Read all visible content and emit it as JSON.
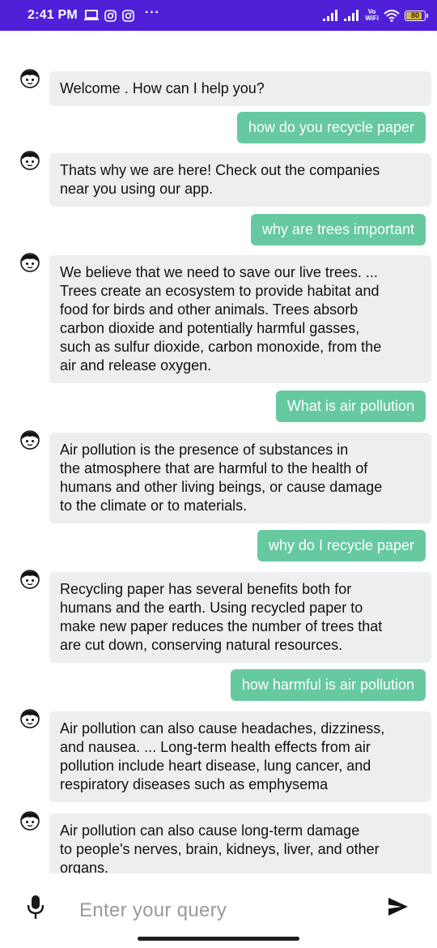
{
  "status_bar": {
    "time": "2:41 PM",
    "icons_left": [
      "laptop-icon",
      "instagram-icon",
      "instagram-icon"
    ],
    "overflow": "···",
    "volte_top": "Vo",
    "volte_bottom": "WiFi",
    "battery": "80"
  },
  "chat": {
    "messages": [
      {
        "from": "bot",
        "text": "Welcome . How can I help you?"
      },
      {
        "from": "user",
        "text": "how do you recycle paper"
      },
      {
        "from": "bot",
        "text": "Thats why we are here! Check out the companies\nnear you using our app."
      },
      {
        "from": "user",
        "text": "why are trees important"
      },
      {
        "from": "bot",
        "text": "We believe that we need to save our live trees. ...\nTrees create an ecosystem to provide habitat and\nfood for birds and other animals. Trees absorb\ncarbon dioxide and potentially harmful gasses,\nsuch as sulfur dioxide, carbon monoxide, from the\nair and release oxygen."
      },
      {
        "from": "user",
        "text": "What is air pollution"
      },
      {
        "from": "bot",
        "text": "Air pollution is the presence of substances in\nthe atmosphere that are harmful to the health of\nhumans and other living beings, or cause damage\nto the climate or to materials."
      },
      {
        "from": "user",
        "text": "why do I recycle paper"
      },
      {
        "from": "bot",
        "text": "Recycling paper has several benefits both for\nhumans and the earth. Using recycled paper to\nmake new paper reduces the number of trees that\nare cut down, conserving natural resources."
      },
      {
        "from": "user",
        "text": "how harmful is air pollution"
      },
      {
        "from": "bot",
        "text": "Air pollution can also cause headaches, dizziness,\nand nausea. ... Long-term health effects from air\npollution include heart disease, lung cancer, and\nrespiratory diseases such as emphysema"
      },
      {
        "from": "bot",
        "text": " Air pollution can also cause long-term damage\nto people's nerves, brain, kidneys, liver, and other\norgans."
      }
    ]
  },
  "input": {
    "placeholder": "Enter your query",
    "mic_icon": "microphone-icon",
    "send_icon": "send-icon"
  },
  "colors": {
    "status_bar": "#4f20d8",
    "user_bubble": "#66c9a0",
    "bot_bubble": "#eceeef"
  }
}
